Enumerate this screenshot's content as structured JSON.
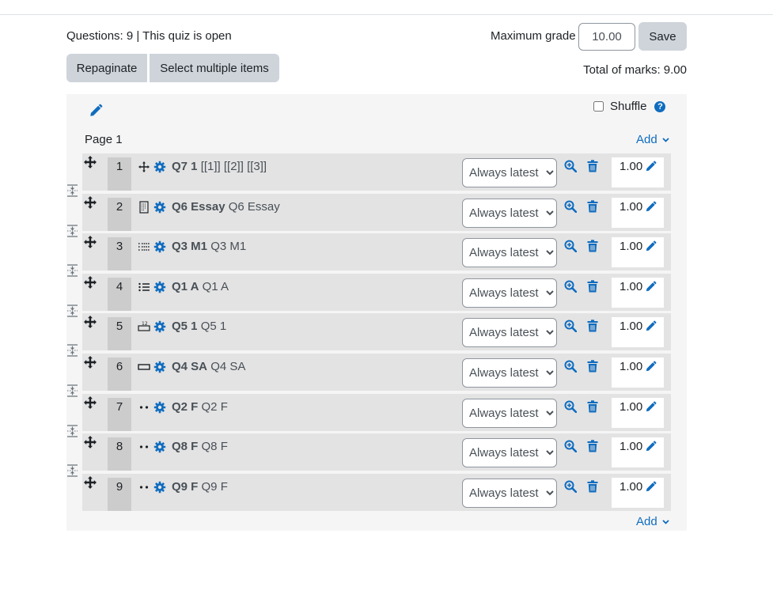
{
  "header": {
    "status_text": "Questions: 9 | This quiz is open",
    "max_grade_label": "Maximum grade",
    "max_grade_value": "10.00",
    "save_label": "Save",
    "repaginate_label": "Repaginate",
    "select_multiple_label": "Select multiple items",
    "total_marks": "Total of marks: 9.00"
  },
  "section": {
    "shuffle_label": "Shuffle",
    "page_label": "Page 1",
    "add_label": "Add"
  },
  "version_option": "Always latest",
  "colors": {
    "accent": "#0f6cbf",
    "row_bg": "#e3e3e3",
    "number_bg": "#cccccc",
    "button_bg": "#ced4da"
  },
  "slots": [
    {
      "number": "1",
      "icon": "ddwtos-icon",
      "name": "Q7 1",
      "text": "[[1]] [[2]] [[3]]",
      "mark": "1.00"
    },
    {
      "number": "2",
      "icon": "essay-icon",
      "name": "Q6 Essay",
      "text": "Q6 Essay",
      "mark": "1.00"
    },
    {
      "number": "3",
      "icon": "multianswer-icon",
      "name": "Q3 M1",
      "text": "Q3 M1",
      "mark": "1.00"
    },
    {
      "number": "4",
      "icon": "multichoice-icon",
      "name": "Q1 A",
      "text": "Q1 A",
      "mark": "1.00"
    },
    {
      "number": "5",
      "icon": "numerical-icon",
      "name": "Q5 1",
      "text": "Q5 1",
      "mark": "1.00"
    },
    {
      "number": "6",
      "icon": "shortanswer-icon",
      "name": "Q4 SA",
      "text": "Q4 SA",
      "mark": "1.00"
    },
    {
      "number": "7",
      "icon": "truefalse-icon",
      "name": "Q2 F",
      "text": "Q2 F",
      "mark": "1.00"
    },
    {
      "number": "8",
      "icon": "truefalse-icon",
      "name": "Q8 F",
      "text": "Q8 F",
      "mark": "1.00"
    },
    {
      "number": "9",
      "icon": "truefalse-icon",
      "name": "Q9 F",
      "text": "Q9 F",
      "mark": "1.00"
    }
  ]
}
